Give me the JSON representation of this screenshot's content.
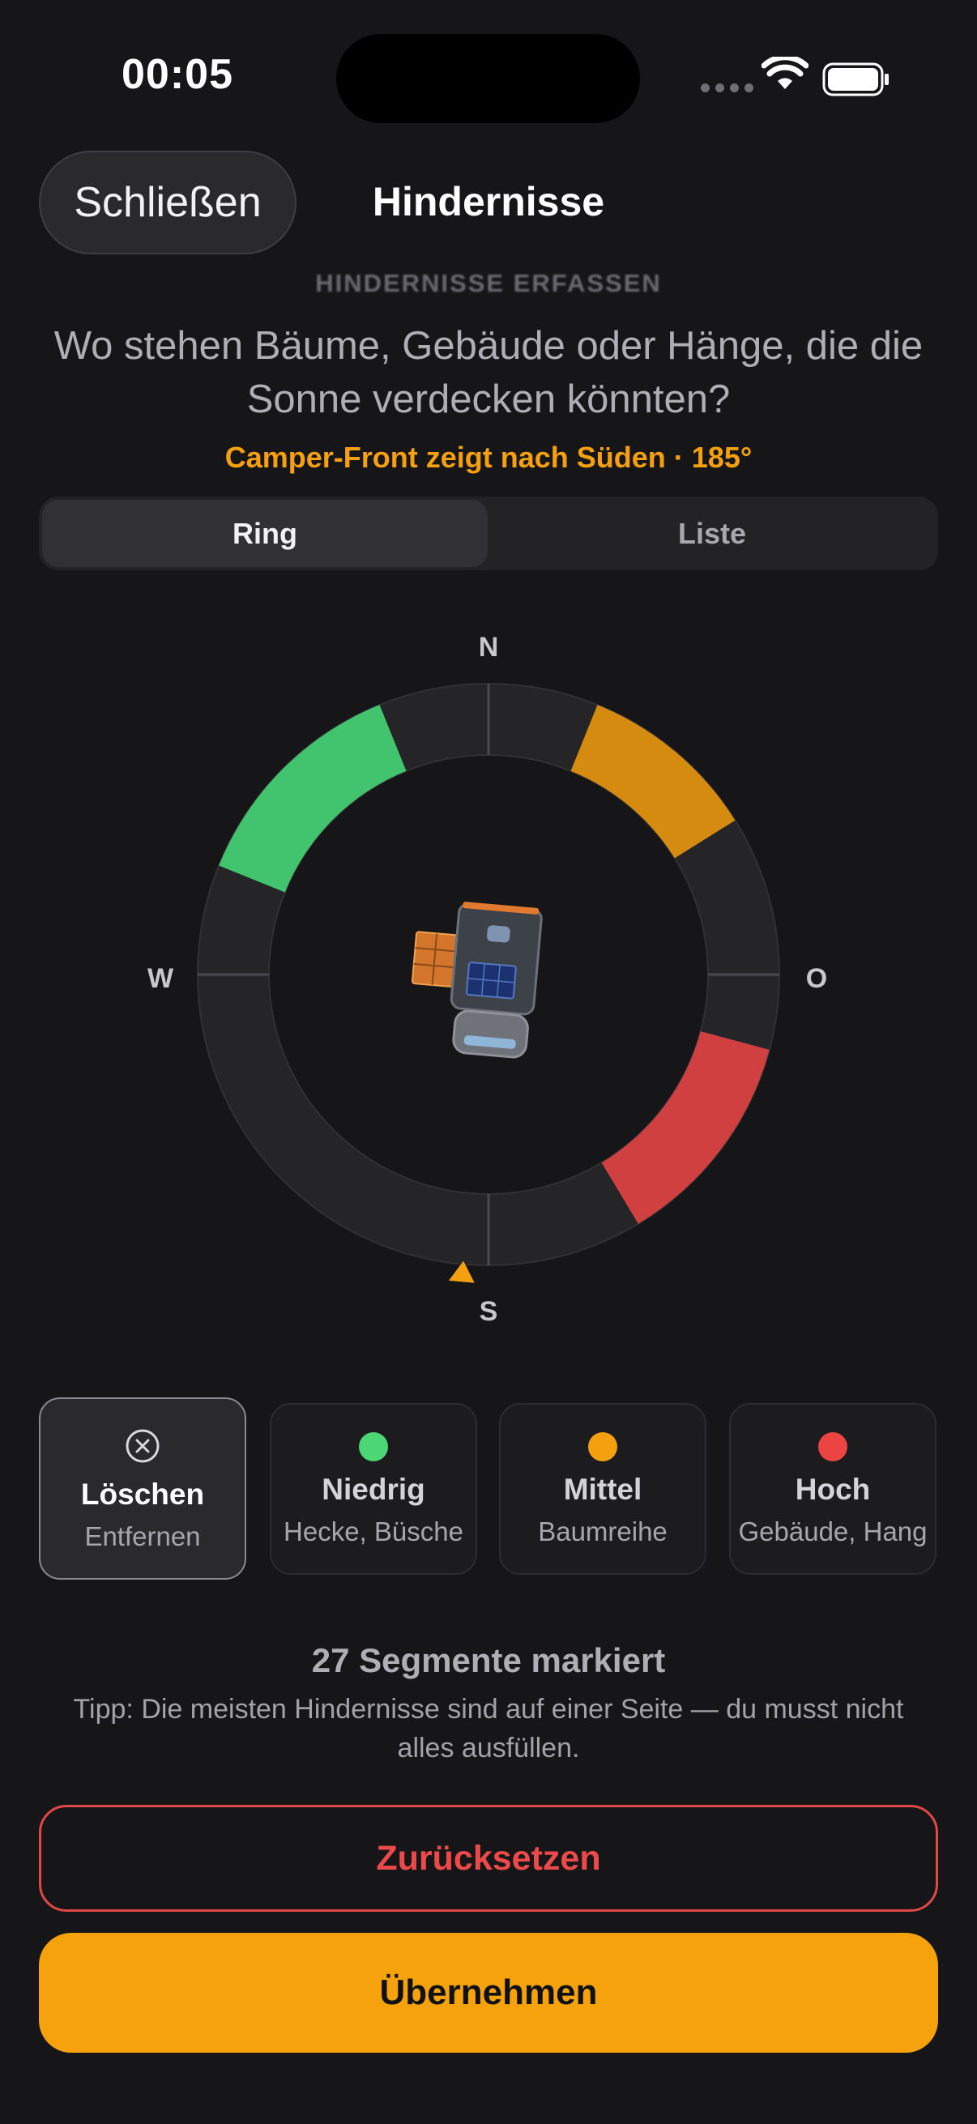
{
  "status_bar": {
    "time": "00:05"
  },
  "nav": {
    "close_label": "Schließen",
    "title": "Hindernisse"
  },
  "header": {
    "kicker": "HINDERNISSE ERFASSEN",
    "question": "Wo stehen Bäume, Gebäude oder Hänge, die die Sonne verdecken könnten?",
    "heading_info": "Camper-Front zeigt nach Süden · 185°"
  },
  "view_toggle": {
    "options": [
      "Ring",
      "Liste"
    ],
    "selected": "Ring"
  },
  "ring": {
    "labels": {
      "north": "N",
      "east": "O",
      "south": "S",
      "west": "W"
    },
    "heading_deg": 185,
    "segments": [
      {
        "level": "niedrig",
        "start_deg": 292,
        "end_deg": 338
      },
      {
        "level": "mittel",
        "start_deg": 22,
        "end_deg": 58
      },
      {
        "level": "hoch",
        "start_deg": 105,
        "end_deg": 149
      }
    ]
  },
  "legend": {
    "items": [
      {
        "title": "Löschen",
        "subtitle": "Entfernen",
        "icon": "x-circle-icon",
        "selected": true
      },
      {
        "title": "Niedrig",
        "subtitle": "Hecke, Büsche",
        "color": "#4cd675",
        "selected": false
      },
      {
        "title": "Mittel",
        "subtitle": "Baumreihe",
        "color": "#f5a00f",
        "selected": false
      },
      {
        "title": "Hoch",
        "subtitle": "Gebäude, Hang",
        "color": "#ec4343",
        "selected": false
      }
    ]
  },
  "summary": {
    "count": "27 Segmente markiert",
    "tip": "Tipp: Die meisten Hindernisse sind auf einer Seite — du musst nicht alles ausfüllen."
  },
  "actions": {
    "reset_label": "Zurücksetzen",
    "apply_label": "Übernehmen"
  },
  "colors": {
    "accent": "#f5a00f",
    "low": "#42c46e",
    "medium": "#d58a10",
    "high": "#d04040",
    "ring_base": "#252528"
  }
}
